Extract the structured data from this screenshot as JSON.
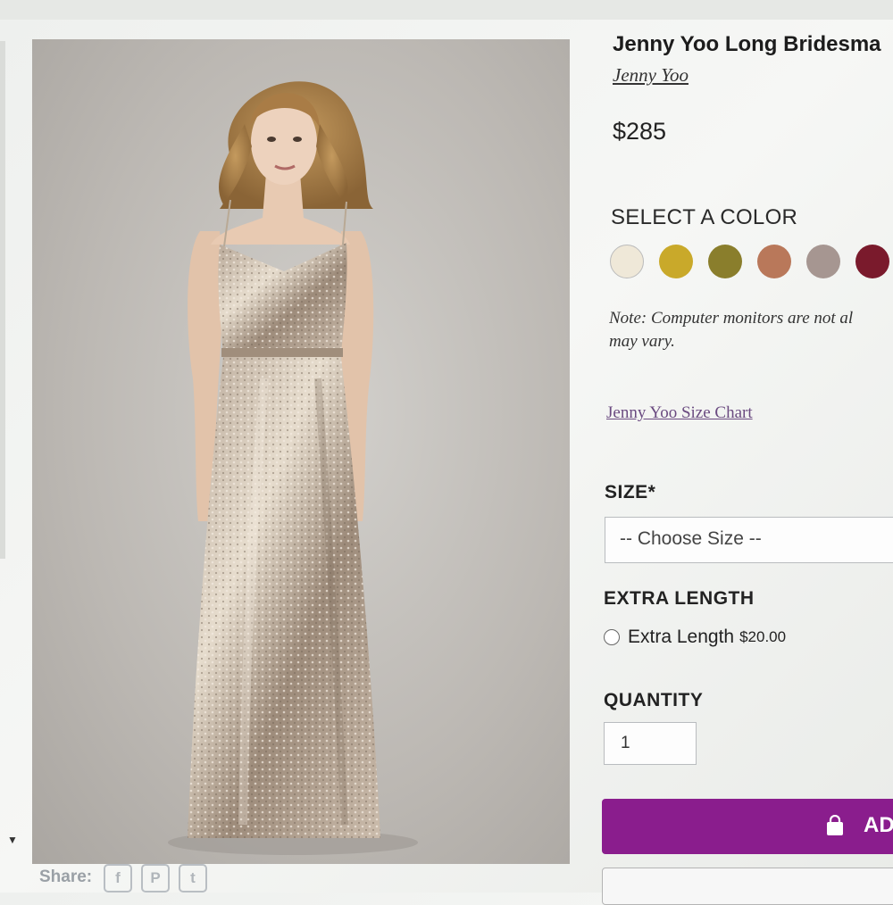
{
  "product": {
    "title": "Jenny Yoo Long Bridesma",
    "brand": "Jenny Yoo",
    "price": "$285"
  },
  "color": {
    "heading": "SELECT A COLOR",
    "swatches": [
      "#efe8d8",
      "#c9a92a",
      "#8a7e2c",
      "#b9785a",
      "#a69691",
      "#7a1a2c"
    ]
  },
  "note": {
    "line1": "Note: Computer monitors are not al",
    "line2": "may vary."
  },
  "size_chart_link": "Jenny Yoo Size Chart",
  "size": {
    "label": "SIZE*",
    "selected": "-- Choose Size --"
  },
  "extra_length": {
    "label": "EXTRA LENGTH",
    "option": "Extra Length",
    "price": "$20.00"
  },
  "quantity": {
    "label": "QUANTITY",
    "value": "1"
  },
  "add_button": {
    "label": "AD"
  },
  "share": {
    "label": "Share:"
  }
}
